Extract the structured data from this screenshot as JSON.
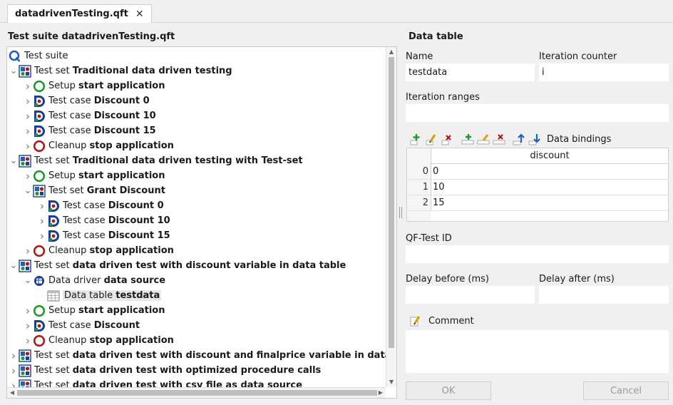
{
  "tab": {
    "title": "datadrivenTesting.qft",
    "close_glyph": "✕"
  },
  "left_panel": {
    "title": "Test suite datadrivenTesting.qft"
  },
  "tree": [
    {
      "level": 0,
      "icon": "suite",
      "chev": "",
      "prefix": "Test suite",
      "name": ""
    },
    {
      "level": 0,
      "icon": "testset",
      "chev": "open",
      "prefix": "Test set",
      "name": "Traditional data driven testing"
    },
    {
      "level": 1,
      "icon": "setup",
      "chev": "closed",
      "prefix": "Setup",
      "name": "start application"
    },
    {
      "level": 1,
      "icon": "testcase",
      "chev": "closed",
      "prefix": "Test case",
      "name": "Discount 0"
    },
    {
      "level": 1,
      "icon": "testcase",
      "chev": "closed",
      "prefix": "Test case",
      "name": "Discount 10"
    },
    {
      "level": 1,
      "icon": "testcase",
      "chev": "closed",
      "prefix": "Test case",
      "name": "Discount 15"
    },
    {
      "level": 1,
      "icon": "cleanup",
      "chev": "closed",
      "prefix": "Cleanup",
      "name": "stop application"
    },
    {
      "level": 0,
      "icon": "testset",
      "chev": "open",
      "prefix": "Test set",
      "name": "Traditional data driven testing with Test-set"
    },
    {
      "level": 1,
      "icon": "setup",
      "chev": "closed",
      "prefix": "Setup",
      "name": "start application"
    },
    {
      "level": 1,
      "icon": "testset",
      "chev": "open",
      "prefix": "Test set",
      "name": "Grant Discount"
    },
    {
      "level": 2,
      "icon": "testcase",
      "chev": "closed",
      "prefix": "Test case",
      "name": "Discount 0"
    },
    {
      "level": 2,
      "icon": "testcase",
      "chev": "closed",
      "prefix": "Test case",
      "name": "Discount 10"
    },
    {
      "level": 2,
      "icon": "testcase",
      "chev": "closed",
      "prefix": "Test case",
      "name": "Discount 15"
    },
    {
      "level": 1,
      "icon": "cleanup",
      "chev": "closed",
      "prefix": "Cleanup",
      "name": "stop application"
    },
    {
      "level": 0,
      "icon": "testset",
      "chev": "open",
      "prefix": "Test set",
      "name": "data driven test with discount variable in data table"
    },
    {
      "level": 1,
      "icon": "datadriver",
      "chev": "open",
      "prefix": "Data driver",
      "name": "data source"
    },
    {
      "level": 2,
      "icon": "datatable",
      "chev": "",
      "prefix": "Data table",
      "name": "testdata",
      "selected": true
    },
    {
      "level": 1,
      "icon": "setup",
      "chev": "closed",
      "prefix": "Setup",
      "name": "start application"
    },
    {
      "level": 1,
      "icon": "testcase",
      "chev": "closed",
      "prefix": "Test case",
      "name": "Discount"
    },
    {
      "level": 1,
      "icon": "cleanup",
      "chev": "closed",
      "prefix": "Cleanup",
      "name": "stop application"
    },
    {
      "level": 0,
      "icon": "testset",
      "chev": "closed",
      "prefix": "Test set",
      "name": "data driven test with discount and finalprice variable in data table"
    },
    {
      "level": 0,
      "icon": "testset",
      "chev": "closed",
      "prefix": "Test set",
      "name": "data driven test with optimized procedure calls"
    },
    {
      "level": 0,
      "icon": "testset",
      "chev": "closed",
      "prefix": "Test set",
      "name": "data driven test with csv file as data source"
    }
  ],
  "detail": {
    "title": "Data table",
    "name_label": "Name",
    "name_value": "testdata",
    "iteration_counter_label": "Iteration counter",
    "iteration_counter_value": "i",
    "iteration_ranges_label": "Iteration ranges",
    "iteration_ranges_value": "",
    "data_bindings_label": "Data bindings",
    "table": {
      "column": "discount",
      "rows": [
        {
          "index": "0",
          "value": "0"
        },
        {
          "index": "1",
          "value": "10"
        },
        {
          "index": "2",
          "value": "15"
        }
      ]
    },
    "qftest_id_label": "QF-Test ID",
    "qftest_id_value": "",
    "delay_before_label": "Delay before (ms)",
    "delay_before_value": "",
    "delay_after_label": "Delay after (ms)",
    "delay_after_value": "",
    "comment_label": "Comment",
    "comment_value": "",
    "ok_label": "OK",
    "cancel_label": "Cancel"
  },
  "colors": {
    "accent_blue": "#1f5fbf",
    "green": "#1c9a2a",
    "red": "#b01818",
    "navy": "#1b3f8f"
  }
}
